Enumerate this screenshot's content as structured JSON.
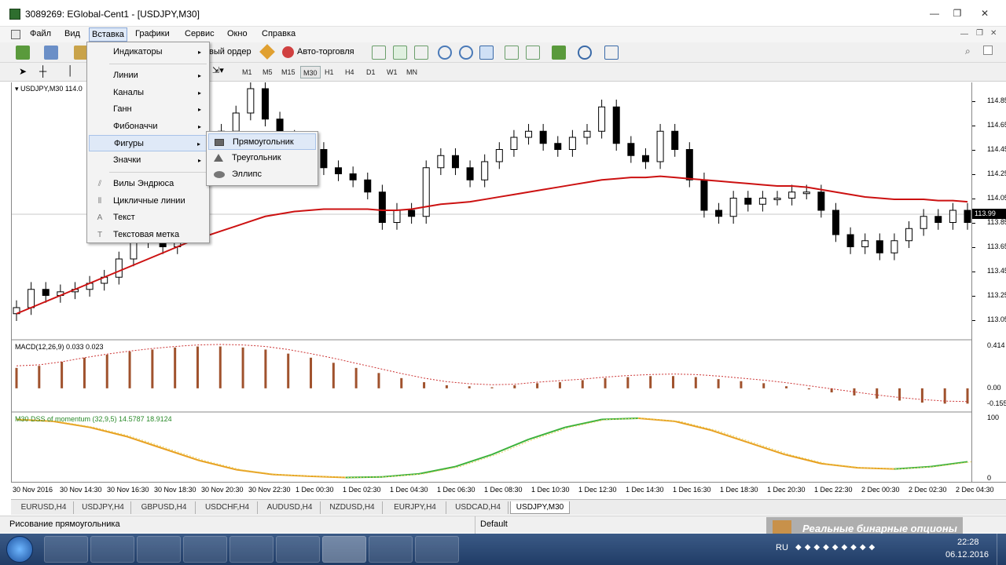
{
  "window": {
    "title": "3089269: EGlobal-Cent1 - [USDJPY,M30]"
  },
  "menubar": {
    "items": [
      "Файл",
      "Вид",
      "Вставка",
      "Графики",
      "Сервис",
      "Окно",
      "Справка"
    ],
    "active": "Вставка"
  },
  "toolbar": {
    "new_order_label": "вый ордер",
    "autotrade_label": "Авто-торговля",
    "timeframes": [
      "M1",
      "M5",
      "M15",
      "M30",
      "H1",
      "H4",
      "D1",
      "W1",
      "MN"
    ],
    "active_timeframe": "M30",
    "search": {
      "value": "",
      "placeholder": ""
    }
  },
  "insert_menu": {
    "items": [
      {
        "label": "Индикаторы",
        "arrow": "▸"
      },
      {
        "label": "Линии",
        "arrow": "▸"
      },
      {
        "label": "Каналы",
        "arrow": "▸"
      },
      {
        "label": "Ганн",
        "arrow": "▸"
      },
      {
        "label": "Фибоначчи",
        "arrow": "▸"
      },
      {
        "label": "Фигуры",
        "arrow": "▸"
      },
      {
        "label": "Значки",
        "arrow": "▸"
      },
      {
        "label": "Вилы Эндрюса"
      },
      {
        "label": "Цикличные линии"
      },
      {
        "label": "Текст"
      },
      {
        "label": "Текстовая метка"
      }
    ],
    "highlighted": "Фигуры"
  },
  "shapes_submenu": {
    "items": [
      {
        "label": "Прямоугольник",
        "icon": "rectangle-icon"
      },
      {
        "label": "Треугольник",
        "icon": "triangle-icon"
      },
      {
        "label": "Эллипс",
        "icon": "ellipse-icon"
      }
    ],
    "highlighted": "Прямоугольник"
  },
  "chart": {
    "symbol_label": "USDJPY,M30  114.0",
    "current_price_tag": "113.99",
    "macd_label": "MACD(12,26,9) 0.033 0.023",
    "dss_label": "M30 DSS of momentum (32,9,5) 14.5787 18.9124"
  },
  "chart_data": [
    {
      "type": "candlestick",
      "symbol": "USDJPY",
      "timeframe": "M30",
      "y_ticks": [
        114.85,
        114.65,
        114.45,
        114.25,
        114.05,
        113.85,
        113.65,
        113.45,
        113.25,
        113.05
      ],
      "ylim": [
        112.95,
        114.95
      ],
      "current_price": 113.99,
      "moving_average_color": "#cc1111",
      "x_tick_labels": [
        "30 Nov 2016",
        "30 Nov 14:30",
        "30 Nov 16:30",
        "30 Nov 18:30",
        "30 Nov 20:30",
        "30 Nov 22:30",
        "1 Dec 00:30",
        "1 Dec 02:30",
        "1 Dec 04:30",
        "1 Dec 06:30",
        "1 Dec 08:30",
        "1 Dec 10:30",
        "1 Dec 12:30",
        "1 Dec 14:30",
        "1 Dec 16:30",
        "1 Dec 18:30",
        "1 Dec 20:30",
        "1 Dec 22:30",
        "2 Dec 00:30",
        "2 Dec 02:30",
        "2 Dec 04:30"
      ],
      "close": [
        113.15,
        113.3,
        113.25,
        113.28,
        113.3,
        113.35,
        113.4,
        113.55,
        113.75,
        113.7,
        113.65,
        113.95,
        114.2,
        114.4,
        114.6,
        114.75,
        114.95,
        114.7,
        114.55,
        114.5,
        114.45,
        114.3,
        114.25,
        114.2,
        114.1,
        113.85,
        113.95,
        113.9,
        114.3,
        114.4,
        114.3,
        114.2,
        114.35,
        114.45,
        114.55,
        114.6,
        114.5,
        114.45,
        114.55,
        114.6,
        114.8,
        114.5,
        114.4,
        114.35,
        114.6,
        114.45,
        114.2,
        113.95,
        113.9,
        114.05,
        114.0,
        114.05,
        114.05,
        114.1,
        114.1,
        113.95,
        113.75,
        113.65,
        113.7,
        113.6,
        113.7,
        113.8,
        113.9,
        113.85,
        113.95,
        113.85
      ],
      "ma": [
        113.1,
        113.15,
        113.2,
        113.25,
        113.3,
        113.35,
        113.4,
        113.45,
        113.5,
        113.55,
        113.6,
        113.65,
        113.7,
        113.74,
        113.78,
        113.82,
        113.86,
        113.9,
        113.92,
        113.94,
        113.95,
        113.96,
        113.96,
        113.96,
        113.96,
        113.95,
        113.95,
        113.96,
        113.98,
        114.0,
        114.01,
        114.02,
        114.04,
        114.06,
        114.08,
        114.1,
        114.12,
        114.14,
        114.16,
        114.18,
        114.2,
        114.21,
        114.22,
        114.22,
        114.23,
        114.22,
        114.21,
        114.2,
        114.19,
        114.18,
        114.17,
        114.16,
        114.15,
        114.15,
        114.14,
        114.12,
        114.1,
        114.08,
        114.06,
        114.05,
        114.04,
        114.04,
        114.04,
        114.03,
        114.03,
        114.02
      ]
    },
    {
      "type": "bar",
      "title": "MACD(12,26,9) 0.033 0.023",
      "y_ticks": [
        0.414,
        0.0,
        -0.155
      ],
      "values": [
        0.2,
        0.22,
        0.26,
        0.3,
        0.33,
        0.36,
        0.38,
        0.4,
        0.41,
        0.41,
        0.4,
        0.38,
        0.34,
        0.3,
        0.25,
        0.2,
        0.15,
        0.1,
        0.06,
        0.03,
        0.02,
        0.01,
        0.03,
        0.05,
        0.06,
        0.08,
        0.1,
        0.11,
        0.12,
        0.12,
        0.11,
        0.09,
        0.07,
        0.05,
        0.02,
        -0.01,
        -0.04,
        -0.07,
        -0.1,
        -0.12,
        -0.14,
        -0.15,
        -0.15
      ]
    },
    {
      "type": "line",
      "title": "M30 DSS of momentum (32,9,5) 14.5787 18.9124",
      "y_ticks": [
        100,
        0
      ],
      "ylim": [
        0,
        100
      ],
      "series": [
        {
          "values": [
            98,
            95,
            85,
            70,
            50,
            30,
            15,
            7,
            4,
            2,
            3,
            8,
            20,
            40,
            65,
            85,
            98,
            100,
            95,
            80,
            60,
            40,
            25,
            18,
            16,
            20,
            28
          ]
        }
      ]
    }
  ],
  "tabs": [
    "EURUSD,H4",
    "USDJPY,H4",
    "GBPUSD,H4",
    "USDCHF,H4",
    "AUDUSD,H4",
    "NZDUSD,H4",
    "EURJPY,H4",
    "USDCAD,H4",
    "USDJPY,M30"
  ],
  "active_tab": "USDJPY,M30",
  "status": {
    "left": "Рисование прямоугольника",
    "profile": "Default"
  },
  "watermark": "Реальные бинарные опционы",
  "taskbar": {
    "lang": "RU",
    "time": "22:28",
    "date": "06.12.2016"
  }
}
